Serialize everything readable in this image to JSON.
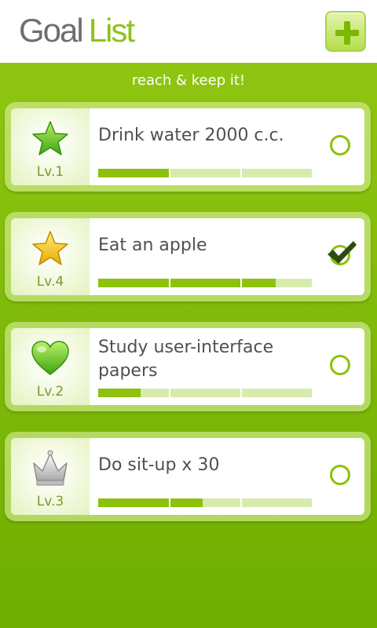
{
  "header": {
    "title_part1": "Goal",
    "title_part2": "List",
    "add_icon": "plus-icon"
  },
  "tagline": "reach & keep it!",
  "goals": [
    {
      "title": "Drink water 2000 c.c.",
      "level": "Lv.1",
      "icon": "green-star-icon",
      "progress": 0.33,
      "completed": false
    },
    {
      "title": "Eat an apple",
      "level": "Lv.4",
      "icon": "gold-star-icon",
      "progress": 0.83,
      "completed": true
    },
    {
      "title": "Study user-interface papers",
      "level": "Lv.2",
      "icon": "green-heart-icon",
      "progress": 0.2,
      "completed": false
    },
    {
      "title": "Do sit-up x 30",
      "level": "Lv.3",
      "icon": "silver-crown-icon",
      "progress": 0.49,
      "completed": false
    }
  ],
  "colors": {
    "accent": "#8cc10d",
    "background": "#86bf0c",
    "text": "#505050"
  }
}
